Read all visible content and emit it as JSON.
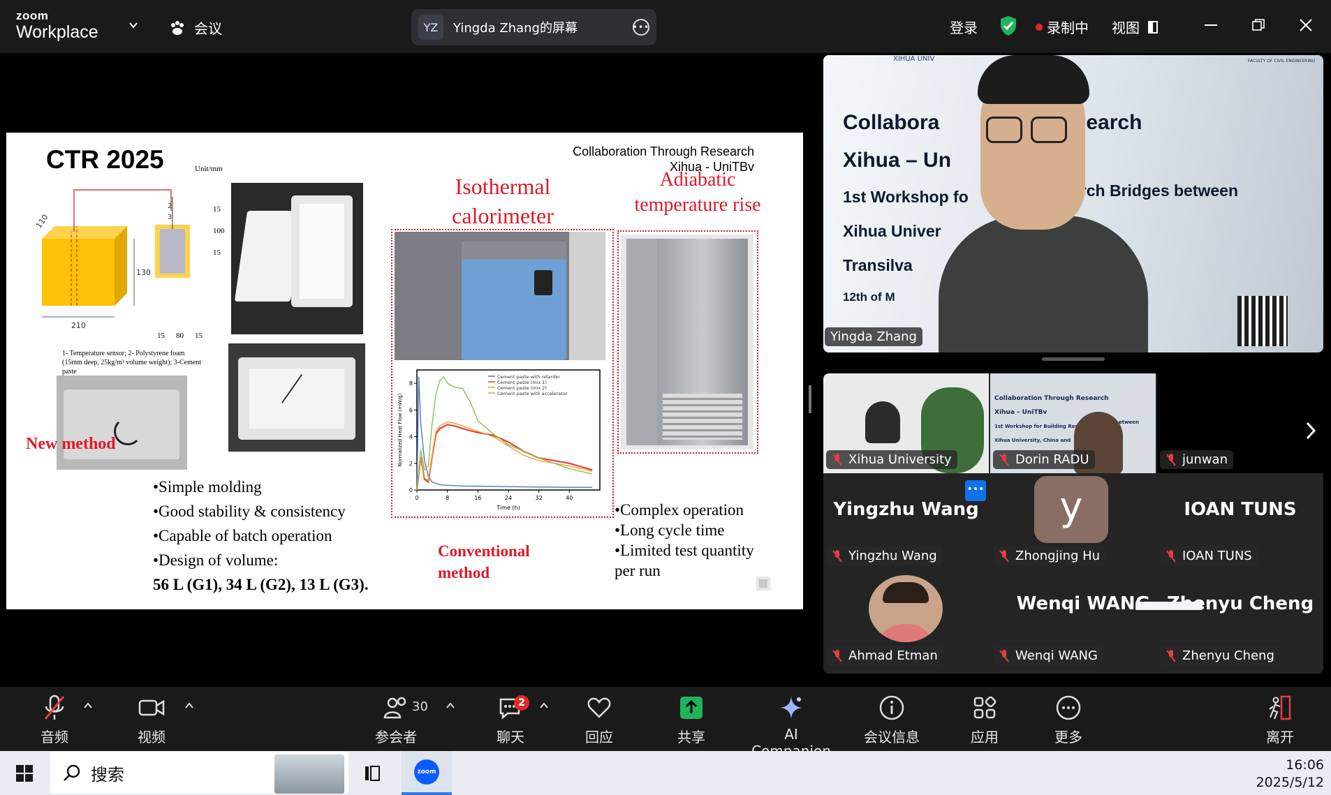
{
  "app": {
    "brand_top": "zoom",
    "brand_bottom": "Workplace"
  },
  "titlebar": {
    "meeting_label": "会议",
    "share_initials": "YZ",
    "share_label": "Yingda Zhang的屏幕",
    "login": "登录",
    "recording": "录制中",
    "view": "视图",
    "colors": {
      "record_dot": "#e02a2a",
      "shield": "#21b35b"
    }
  },
  "slide": {
    "title": "CTR 2025",
    "collab_line1": "Collaboration Through Research",
    "collab_line2": "Xihua - UniTBv",
    "isothermal_title": "Isothermal calorimeter",
    "adiabatic_title": "Adiabatic temperature rise",
    "conventional": "Conventional method",
    "new_method": "New method",
    "diagram": {
      "unit": "Unit/mm",
      "dim_110": "110",
      "dim_130": "130",
      "dim_210": "210",
      "dim_100": "100",
      "dim_15a": "15",
      "dim_15b": "15",
      "dim_15c": "15",
      "dim_80": "80",
      "dim_15d": "15",
      "n1": "1",
      "n2": "2",
      "n3": "3",
      "caption": "1- Temperature sensor; 2- Polystyrene foam (15mm deep, 25kg/m³ volume weight); 3-Cement paste"
    },
    "new_bullets": [
      "•Simple molding",
      "•Good stability & consistency",
      "•Capable of batch operation",
      "•Design of volume:"
    ],
    "volume_line": "56 L (G1), 34 L (G2), 13 L (G3).",
    "conv_bullets": [
      "•Complex operation",
      "•Long cycle time",
      "•Limited test quantity",
      "per run"
    ]
  },
  "chart_data": {
    "type": "line",
    "xlabel": "Time (h)",
    "ylabel": "Normalized Heat Flow (mW/g)",
    "xlim": [
      0,
      48
    ],
    "ylim": [
      0,
      9
    ],
    "xticks": [
      0,
      8,
      16,
      24,
      32,
      40
    ],
    "yticks": [
      0,
      2,
      4,
      6,
      8
    ],
    "legend_position": "top-right",
    "series": [
      {
        "name": "Cement paste with retarder",
        "color": "#4a78c8",
        "x": [
          0,
          0.5,
          1,
          2,
          3,
          4,
          6,
          8,
          12,
          16,
          24,
          32,
          40,
          46
        ],
        "y": [
          0,
          8.5,
          5,
          2.2,
          1,
          0.6,
          0.4,
          0.35,
          0.3,
          0.28,
          0.25,
          0.22,
          0.2,
          0.2
        ]
      },
      {
        "name": "Cement paste (mix 1)",
        "color": "#e5443a",
        "x": [
          0,
          1,
          2,
          3,
          4,
          5,
          6,
          8,
          10,
          12,
          16,
          20,
          24,
          28,
          32,
          40,
          46
        ],
        "y": [
          0,
          2.5,
          0.8,
          0.6,
          2.5,
          4.2,
          4.6,
          4.9,
          4.8,
          4.6,
          4.3,
          4.1,
          3.6,
          2.9,
          2.4,
          2.0,
          1.5
        ]
      },
      {
        "name": "Cement paste (mix 2)",
        "color": "#f0a030",
        "x": [
          0,
          1,
          2,
          3,
          4,
          5,
          6,
          8,
          10,
          12,
          16,
          20,
          24,
          28,
          32,
          40,
          46
        ],
        "y": [
          0,
          2.5,
          0.9,
          0.7,
          2.6,
          4.4,
          4.8,
          5.1,
          5.0,
          4.8,
          4.4,
          4.0,
          3.3,
          2.6,
          2.2,
          1.8,
          1.4
        ]
      },
      {
        "name": "Cement paste with accelerator",
        "color": "#8cc24a",
        "x": [
          0,
          1,
          2,
          3,
          4,
          5,
          6,
          7,
          8,
          10,
          12,
          14,
          16,
          20,
          24,
          32,
          40,
          46
        ],
        "y": [
          0,
          3,
          1.5,
          1.8,
          5,
          7.2,
          8.2,
          8.5,
          8.0,
          7.7,
          7.6,
          6.6,
          5.2,
          4.2,
          3.4,
          2.4,
          1.6,
          1.2
        ]
      }
    ]
  },
  "speaker": {
    "name": "Yingda Zhang",
    "bg_lines": [
      "Collabora",
      "esearch",
      "Xihua – Un",
      "1st Workshop fo",
      "arch Bridges between",
      "Xihua Univer",
      "Transilva",
      "12th of M"
    ],
    "header_small": "XIHUA UNIV",
    "faculty": "FACULTY OF CIVIL ENGINEERING"
  },
  "participants": [
    {
      "name": "Xihua University"
    },
    {
      "name": "Dorin RADU"
    },
    {
      "name": "junwan"
    },
    {
      "name": "Yingzhu Wang",
      "big": "Yingzhu Wang"
    },
    {
      "name": "Zhongjing Hu",
      "initial": "y"
    },
    {
      "name": "IOAN TUNS",
      "big": "IOAN TUNS"
    },
    {
      "name": "Ahmad Etman"
    },
    {
      "name": "Wenqi WANG",
      "big": "Wenqi WANG"
    },
    {
      "name": "Zhenyu Cheng",
      "big": "Zhenyu Cheng"
    }
  ],
  "tile_texts": {
    "dorin_bg": [
      "Collaboration Through Research",
      "Xihua – UniTBv",
      "1st Workshop for Building Resea",
      "Xihua University, China and",
      "etween"
    ]
  },
  "toolbar": {
    "audio": "音频",
    "video": "视频",
    "participants": "参会者",
    "participants_count": "30",
    "chat": "聊天",
    "chat_badge": "2",
    "react": "回应",
    "share": "共享",
    "ai": "AI Companion",
    "info": "会议信息",
    "apps": "应用",
    "more": "更多",
    "leave": "离开"
  },
  "taskbar": {
    "search": "搜索",
    "time": "16:06",
    "date": "2025/5/12",
    "zoom_label": "zoom"
  }
}
